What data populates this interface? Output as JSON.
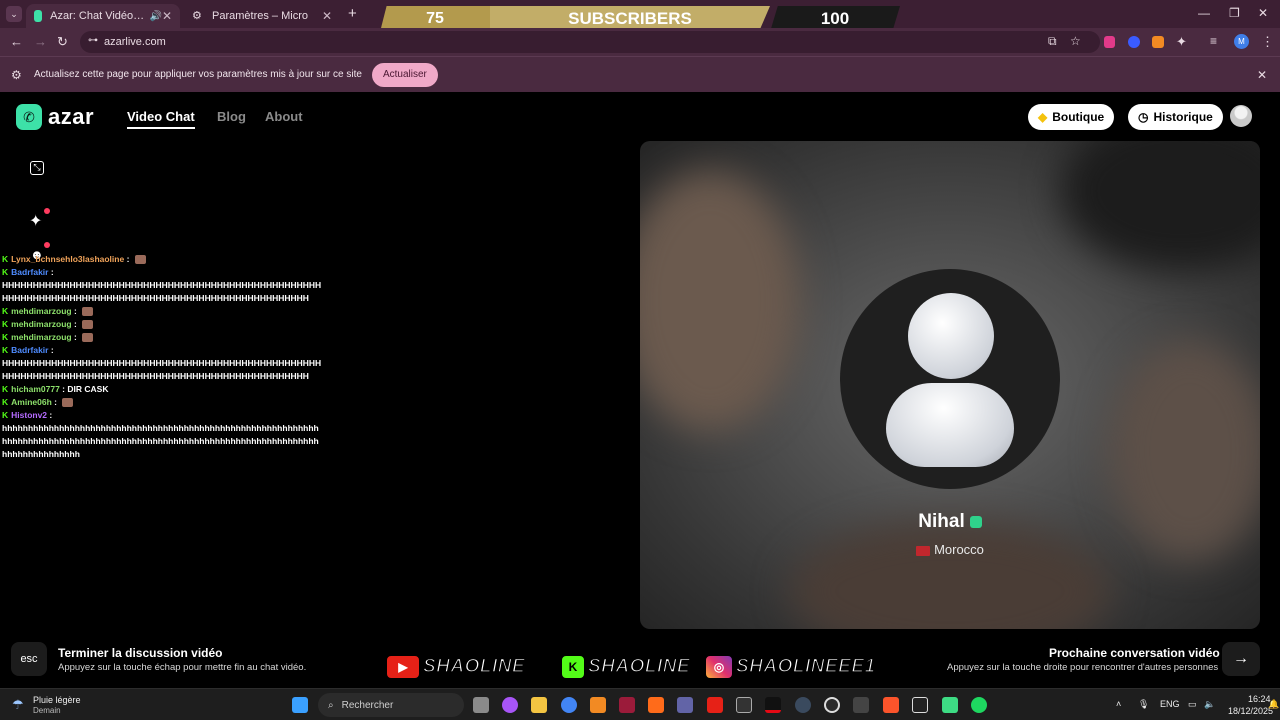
{
  "tabs": [
    {
      "title": "Azar: Chat Vidéo, Rencontre",
      "active": true,
      "audio": true
    },
    {
      "title": "Paramètres – Micro",
      "active": false
    }
  ],
  "overlay": {
    "left": "75",
    "middle": "SUBSCRIBERS",
    "right": "100"
  },
  "address": {
    "url": "azarlive.com"
  },
  "infobar": {
    "message": "Actualisez cette page pour appliquer vos paramètres mis à jour sur ce site",
    "button": "Actualiser"
  },
  "site": {
    "brand": "azar",
    "nav": [
      "Video Chat",
      "Blog",
      "About"
    ],
    "boutique": "Boutique",
    "historique": "Historique"
  },
  "chat": [
    {
      "user": "Lynx_bchnsehlo3lashaoline",
      "color": "#f0a35a",
      "text": "",
      "emote": true
    },
    {
      "user": "Badrfakir",
      "color": "#4f8cff",
      "text": ""
    },
    {
      "spam": "HHHHHHHHHHHHHHHHHHHHHHHHHHHHHHHHHHHHHHHHHHHHHHHHHHHH"
    },
    {
      "spam": "HHHHHHHHHHHHHHHHHHHHHHHHHHHHHHHHHHHHHHHHHHHHHHHHHH"
    },
    {
      "user": "mehdimarzoug",
      "color": "#8de06b",
      "text": "",
      "emote": true
    },
    {
      "user": "mehdimarzoug",
      "color": "#8de06b",
      "text": "",
      "emote": true
    },
    {
      "user": "mehdimarzoug",
      "color": "#8de06b",
      "text": "",
      "emote": true
    },
    {
      "user": "Badrfakir",
      "color": "#4f8cff",
      "text": ""
    },
    {
      "spam": "HHHHHHHHHHHHHHHHHHHHHHHHHHHHHHHHHHHHHHHHHHHHHHHHHHHH"
    },
    {
      "spam": "HHHHHHHHHHHHHHHHHHHHHHHHHHHHHHHHHHHHHHHHHHHHHHHHHH"
    },
    {
      "user": "hicham0777",
      "color": "#8de06b",
      "text": "DIR CASK"
    },
    {
      "user": "Amine06h",
      "color": "#8de06b",
      "text": "",
      "emote": true
    },
    {
      "user": "Histonv2",
      "color": "#b56bff",
      "text": ""
    },
    {
      "spam": "hhhhhhhhhhhhhhhhhhhhhhhhhhhhhhhhhhhhhhhhhhhhhhhhhhhhhhhhhhhhh"
    },
    {
      "spam": "hhhhhhhhhhhhhhhhhhhhhhhhhhhhhhhhhhhhhhhhhhhhhhhhhhhhhhhhhhhhh"
    },
    {
      "spam": "hhhhhhhhhhhhhhh"
    }
  ],
  "partner": {
    "name": "Nihal",
    "country": "Morocco"
  },
  "footer": {
    "esc_key": "esc",
    "end_title": "Terminer la discussion vidéo",
    "end_sub": "Appuyez sur la touche échap pour mettre fin au chat vidéo.",
    "next_title": "Prochaine conversation vidéo",
    "next_sub": "Appuyez sur la touche droite pour rencontrer d'autres personnes"
  },
  "socials": [
    {
      "platform": "youtube",
      "handle": "SHAOLINE",
      "color": "#e62117",
      "glyph": "▶"
    },
    {
      "platform": "kick",
      "handle": "SHAOLINE",
      "color": "#53fc18",
      "glyph": "K"
    },
    {
      "platform": "instagram",
      "handle": "SHAOLINEEE1",
      "color": "#d6249f",
      "glyph": "◎"
    }
  ],
  "taskbar": {
    "weather": "Pluie légère",
    "weather_sub": "Demain",
    "search": "Rechercher",
    "lang": "ENG",
    "time": "16:24",
    "date": "18/12/2025"
  }
}
